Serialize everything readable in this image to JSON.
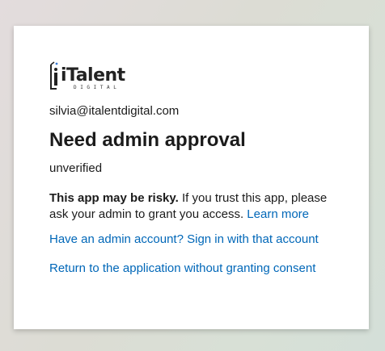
{
  "logo": {
    "name": "iTalent",
    "tagline": "DIGITAL"
  },
  "account_email": "silvia@italentdigital.com",
  "heading": "Need admin approval",
  "status": "unverified",
  "risk_notice": {
    "bold": "This app may be risky.",
    "text": "If you trust this app, please ask your admin to grant you access.",
    "learn_more": "Learn more"
  },
  "links": {
    "admin_sign_in": "Have an admin account? Sign in with that account",
    "return_without_consent": "Return to the application without granting consent"
  },
  "colors": {
    "link": "#0067b8",
    "text": "#1b1b1b",
    "card": "#ffffff"
  }
}
